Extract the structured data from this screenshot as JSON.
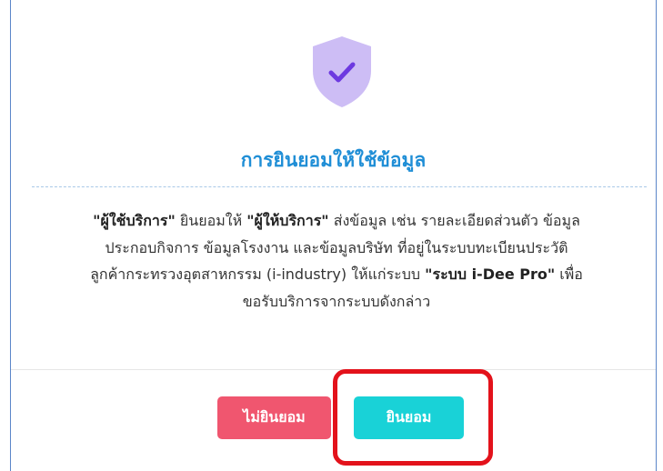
{
  "dialog": {
    "icon": "shield-check-icon",
    "title": "การยินยอมให้ใช้ข้อมูล",
    "body": {
      "line1": {
        "bold1": "\"ผู้ใช้บริการ\"",
        "text1": " ยินยอมให้ ",
        "bold2": "\"ผู้ให้บริการ\"",
        "text2": " ส่งข้อมูล เช่น รายละเอียดส่วนตัว ข้อมูล"
      },
      "line2": "ประกอบกิจการ ข้อมูลโรงงาน และข้อมูลบริษัท ที่อยู่ในระบบทะเบียนประวัติ",
      "line3": {
        "text1": "ลูกค้ากระทรวงอุตสาหกรรม (i-industry) ให้แก่ระบบ ",
        "bold1": "\"ระบบ i-Dee Pro\"",
        "text2": " เพื่อ"
      },
      "line4": "ขอรับบริการจากระบบดังกล่าว"
    },
    "buttons": {
      "decline_label": "ไม่ยินยอม",
      "accept_label": "ยินยอม"
    }
  },
  "colors": {
    "title": "#1f8ed6",
    "shield": "#cdbdf5",
    "check": "#6d39e0",
    "decline": "#f0566f",
    "accept": "#19d2d7",
    "highlight": "#e3121b"
  }
}
